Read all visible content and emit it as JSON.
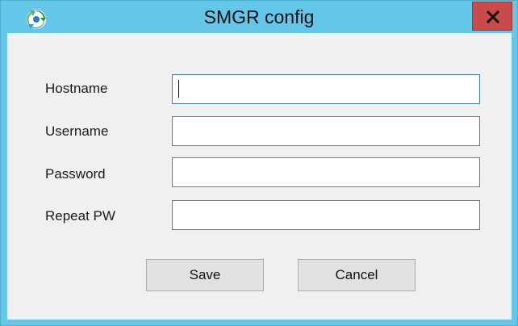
{
  "window": {
    "title": "SMGR config",
    "icon": "recycle-arrows-icon",
    "close_icon": "close-icon",
    "colors": {
      "titlebar": "#65c7e8",
      "close": "#c94a4a",
      "client": "#f0f0f0"
    }
  },
  "form": {
    "hostname": {
      "label": "Hostname",
      "value": ""
    },
    "username": {
      "label": "Username",
      "value": ""
    },
    "password": {
      "label": "Password",
      "value": ""
    },
    "repeat_pw": {
      "label": "Repeat PW",
      "value": ""
    }
  },
  "buttons": {
    "save_label": "Save",
    "cancel_label": "Cancel"
  }
}
